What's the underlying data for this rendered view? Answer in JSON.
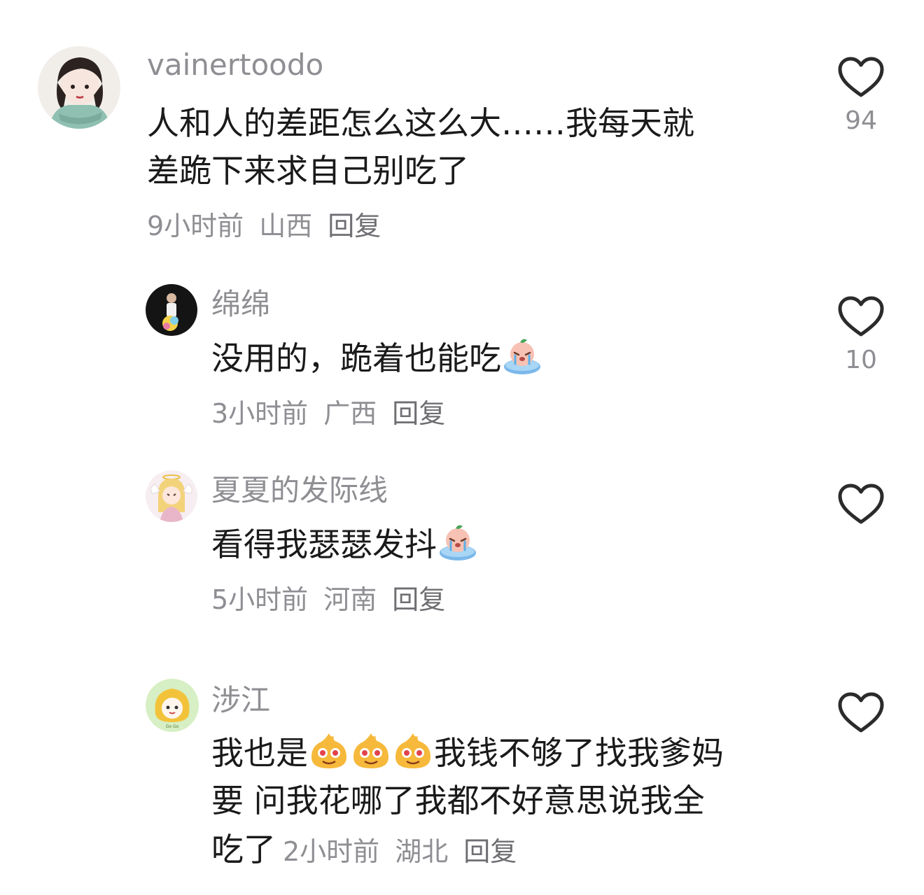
{
  "comments": [
    {
      "username": "vainertoodo",
      "text_line1": "人和人的差距怎么这么大……我每天就",
      "text_line2": "差跪下来求自己别吃了",
      "time": "9小时前",
      "location": "山西",
      "reply_label": "回复",
      "like_count": "94",
      "avatar_icon": "avatar-girl-scarf-icon"
    },
    {
      "username": "绵绵",
      "text": "没用的，跪着也能吃",
      "emoji": "crying-peach-emoji",
      "time": "3小时前",
      "location": "广西",
      "reply_label": "回复",
      "like_count": "10",
      "avatar_icon": "avatar-stage-performer-icon"
    },
    {
      "username": "夏夏的发际线",
      "text": "看得我瑟瑟发抖",
      "emoji": "crying-peach-emoji",
      "time": "5小时前",
      "location": "河南",
      "reply_label": "回复",
      "like_count": "",
      "avatar_icon": "avatar-angel-girl-icon"
    },
    {
      "username": "涉江",
      "text_part1": "我也是",
      "text_part2": "我钱不够了找我爹妈",
      "text_line2": "要 问我花哪了我都不好意思说我全",
      "text_line3": "吃了",
      "emoji": "drooling-face-emoji",
      "emoji_count": 3,
      "time": "2小时前",
      "location": "湖北",
      "reply_label": "回复",
      "like_count": "",
      "avatar_icon": "avatar-cartoon-girl-icon"
    }
  ],
  "colors": {
    "text_primary": "#1a1a1a",
    "text_secondary": "#8e8e93",
    "heart_outline": "#2b2b2b",
    "background": "#ffffff"
  }
}
